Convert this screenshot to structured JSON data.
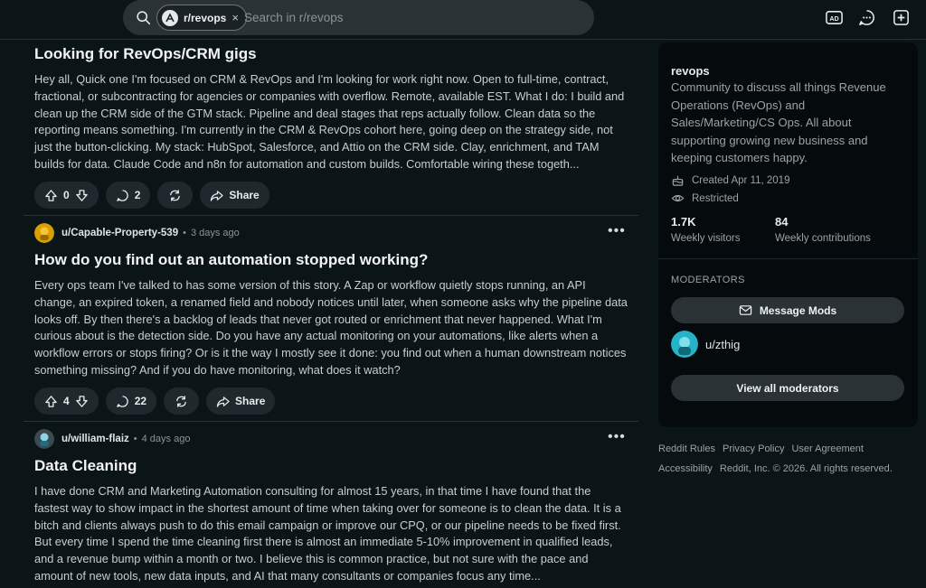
{
  "header": {
    "search_chip": "r/revops",
    "search_chip_close": "×",
    "search_placeholder": "Search in r/revops",
    "icons": [
      "ad-icon",
      "chat-icon",
      "create-post-icon"
    ]
  },
  "posts": [
    {
      "title": "Looking for RevOps/CRM gigs",
      "body": "Hey all, Quick one I'm focused on CRM & RevOps and I'm looking for work right now. Open to full-time, contract, fractional, or subcontracting for agencies or companies with overflow. Remote, available EST. What I do: I build and clean up the CRM side of the GTM stack. Pipeline and deal stages that reps actually follow. Clean data so the reporting means something. I'm currently in the CRM & RevOps cohort here, going deep on the strategy side, not just the button-clicking. My stack: HubSpot, Salesforce, and Attio on the CRM side. Clay, enrichment, and TAM builds for data. Claude Code and n8n for automation and custom builds. Comfortable wiring these togeth...",
      "votes": "0",
      "comments": "2",
      "share": "Share"
    },
    {
      "author": "u/Capable-Property-539",
      "dot": "•",
      "time": "3 days ago",
      "more": "•••",
      "title": "How do you find out an automation stopped working?",
      "body": "Every ops team I've talked to has some version of this story. A Zap or workflow quietly stops running, an API change, an expired token, a renamed field and nobody notices until later, when someone asks why the pipeline data looks off. By then there's a backlog of leads that never got routed or enrichment that never happened. What I'm curious about is the detection side. Do you have any actual monitoring on your automations, like alerts when a workflow errors or stops firing? Or is it the way I mostly see it done: you find out when a human downstream notices something missing? And if you do have monitoring, what does it watch?",
      "votes": "4",
      "comments": "22",
      "share": "Share"
    },
    {
      "author": "u/william-flaiz",
      "dot": "•",
      "time": "4 days ago",
      "more": "•••",
      "title": "Data Cleaning",
      "body": "I have done CRM and Marketing Automation consulting for almost 15 years, in that time I have found that the fastest way to show impact in the shortest amount of time when taking over for someone is to clean the data. It is a bitch and clients always push to do this email campaign or improve our CPQ, or our pipeline needs to be fixed first. But every time I spend the time cleaning first there is almost an immediate 5-10% improvement in qualified leads, and a revenue bump within a month or two. I believe this is common practice, but not sure with the pace and amount of new tools, new data inputs, and AI that many consultants or companies focus any time..."
    }
  ],
  "sidebar": {
    "name": "revops",
    "description": "Community to discuss all things Revenue Operations (RevOps) and Sales/Marketing/CS Ops. All about supporting growing new business and keeping customers happy.",
    "created": "Created Apr 11, 2019",
    "restricted": "Restricted",
    "stats": [
      {
        "value": "1.7K",
        "label": "Weekly visitors"
      },
      {
        "value": "84",
        "label": "Weekly contributions"
      }
    ],
    "moderators_heading": "MODERATORS",
    "message_mods": "Message Mods",
    "moderator": "u/zthig",
    "view_all": "View all moderators"
  },
  "footer": {
    "links": [
      "Reddit Rules",
      "Privacy Policy",
      "User Agreement"
    ],
    "accessibility": "Accessibility",
    "copyright": "Reddit, Inc. © 2026. All rights reserved."
  },
  "colors": {
    "background": "#0b1416",
    "sidebar": "#050a0c",
    "pill": "#1f292d"
  }
}
